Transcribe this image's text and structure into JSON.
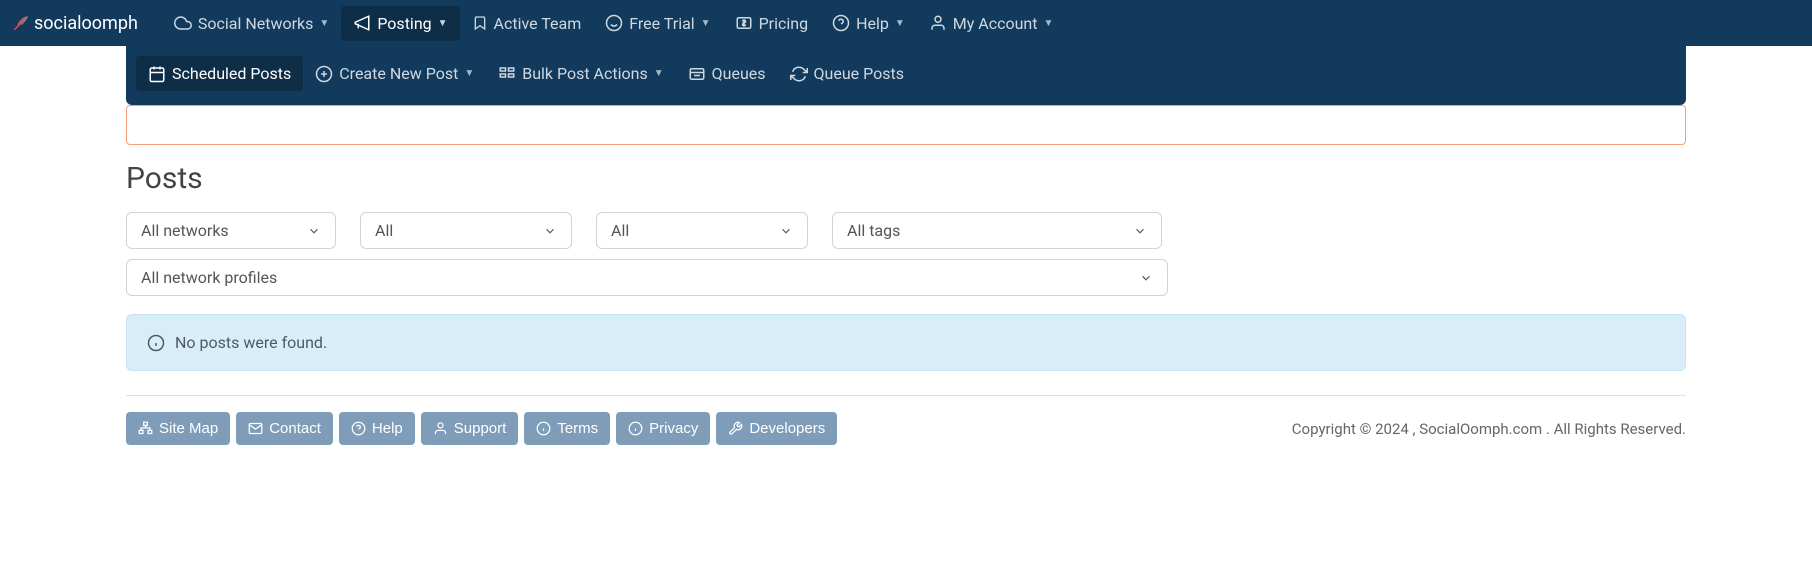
{
  "brand": {
    "name": "socialoomph"
  },
  "topnav": {
    "items": [
      {
        "label": "Social Networks",
        "hasCaret": true
      },
      {
        "label": "Posting",
        "hasCaret": true
      },
      {
        "label": "Active Team",
        "hasCaret": false
      },
      {
        "label": "Free Trial",
        "hasCaret": true
      },
      {
        "label": "Pricing",
        "hasCaret": false
      },
      {
        "label": "Help",
        "hasCaret": true
      },
      {
        "label": "My Account",
        "hasCaret": true
      }
    ]
  },
  "subnav": {
    "items": [
      {
        "label": "Scheduled Posts",
        "hasCaret": false
      },
      {
        "label": "Create New Post",
        "hasCaret": true
      },
      {
        "label": "Bulk Post Actions",
        "hasCaret": true
      },
      {
        "label": "Queues",
        "hasCaret": false
      },
      {
        "label": "Queue Posts",
        "hasCaret": false
      }
    ]
  },
  "page": {
    "title": "Posts"
  },
  "filters": {
    "networks": "All networks",
    "filter2": "All",
    "filter3": "All",
    "tags": "All tags",
    "profiles": "All network profiles"
  },
  "info": {
    "message": "No posts were found."
  },
  "footer": {
    "buttons": [
      {
        "label": "Site Map"
      },
      {
        "label": "Contact"
      },
      {
        "label": "Help"
      },
      {
        "label": "Support"
      },
      {
        "label": "Terms"
      },
      {
        "label": "Privacy"
      },
      {
        "label": "Developers"
      }
    ],
    "copyright": "Copyright © 2024 , SocialOomph.com . All Rights Reserved."
  }
}
